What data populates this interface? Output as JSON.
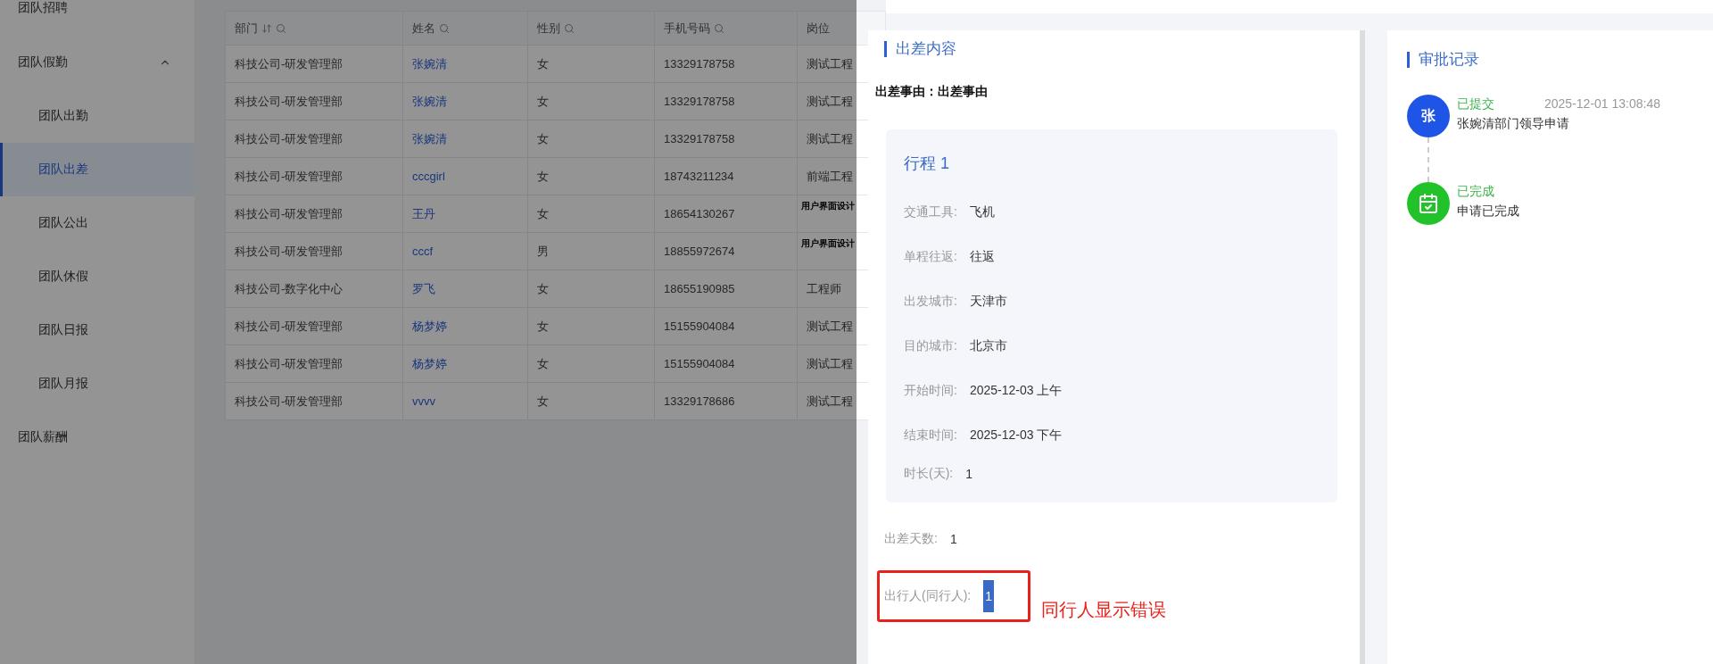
{
  "sidebar": {
    "items": [
      {
        "label": "团队招聘"
      },
      {
        "label": "团队假勤",
        "expanded": true,
        "children": [
          {
            "label": "团队出勤",
            "selected": false
          },
          {
            "label": "团队出差",
            "selected": true
          },
          {
            "label": "团队公出",
            "selected": false
          },
          {
            "label": "团队休假",
            "selected": false
          },
          {
            "label": "团队日报",
            "selected": false
          },
          {
            "label": "团队月报",
            "selected": false
          }
        ]
      },
      {
        "label": "团队薪酬"
      }
    ]
  },
  "table": {
    "columns": [
      {
        "label": "部门",
        "sortable": true,
        "searchable": true,
        "kind": "text"
      },
      {
        "label": "姓名",
        "sortable": false,
        "searchable": true,
        "kind": "link"
      },
      {
        "label": "性别",
        "sortable": false,
        "searchable": true,
        "kind": "text"
      },
      {
        "label": "手机号码",
        "sortable": false,
        "searchable": true,
        "kind": "text"
      },
      {
        "label": "岗位",
        "sortable": false,
        "searchable": false,
        "kind": "text"
      }
    ],
    "rows": [
      {
        "cells": [
          "科技公司-研发管理部",
          "张婉清",
          "女",
          "13329178758",
          "测试工程"
        ],
        "compact": false
      },
      {
        "cells": [
          "科技公司-研发管理部",
          "张婉清",
          "女",
          "13329178758",
          "测试工程"
        ],
        "compact": false
      },
      {
        "cells": [
          "科技公司-研发管理部",
          "张婉清",
          "女",
          "13329178758",
          "测试工程"
        ],
        "compact": false
      },
      {
        "cells": [
          "科技公司-研发管理部",
          "cccgirl",
          "女",
          "18743211234",
          "前端工程"
        ],
        "compact": false
      },
      {
        "cells": [
          "科技公司-研发管理部",
          "王丹",
          "女",
          "18654130267",
          "用户界面设计"
        ],
        "compact": true
      },
      {
        "cells": [
          "科技公司-研发管理部",
          "cccf",
          "男",
          "18855972674",
          "用户界面设计"
        ],
        "compact": true
      },
      {
        "cells": [
          "科技公司-数字化中心",
          "罗飞",
          "女",
          "18655190985",
          "工程师"
        ],
        "compact": false
      },
      {
        "cells": [
          "科技公司-研发管理部",
          "杨梦婷",
          "女",
          "15155904084",
          "测试工程"
        ],
        "compact": false
      },
      {
        "cells": [
          "科技公司-研发管理部",
          "杨梦婷",
          "女",
          "15155904084",
          "测试工程"
        ],
        "compact": false
      },
      {
        "cells": [
          "科技公司-研发管理部",
          "vvvv",
          "女",
          "13329178686",
          "测试工程"
        ],
        "compact": false
      }
    ]
  },
  "detail": {
    "title": "出差内容",
    "reason": "出差事由：出差事由",
    "trip": {
      "title": "行程 1",
      "fields": [
        {
          "label": "交通工具:",
          "value": "飞机"
        },
        {
          "label": "单程往返:",
          "value": "往返"
        },
        {
          "label": "出发城市:",
          "value": "天津市"
        },
        {
          "label": "目的城市:",
          "value": "北京市"
        },
        {
          "label": "开始时间:",
          "value": "2025-12-03 上午"
        },
        {
          "label": "结束时间:",
          "value": "2025-12-03 下午"
        },
        {
          "label": "时长(天):",
          "value": "1"
        }
      ]
    },
    "fields": [
      {
        "label": "出差天数:",
        "value": "1",
        "highlighted": false,
        "flagged": false
      },
      {
        "label": "出行人(同行人):",
        "value": "1",
        "highlighted": true,
        "flagged": true
      }
    ],
    "annotation": "同行人显示错误"
  },
  "approval": {
    "title": "审批记录",
    "records": [
      {
        "kind": "avatar",
        "avatar": "张",
        "status": "已提交",
        "time": "2025-12-01 13:08:48",
        "description": "张婉清部门领导申请"
      },
      {
        "kind": "done",
        "status": "已完成",
        "description": "申请已完成"
      }
    ]
  }
}
